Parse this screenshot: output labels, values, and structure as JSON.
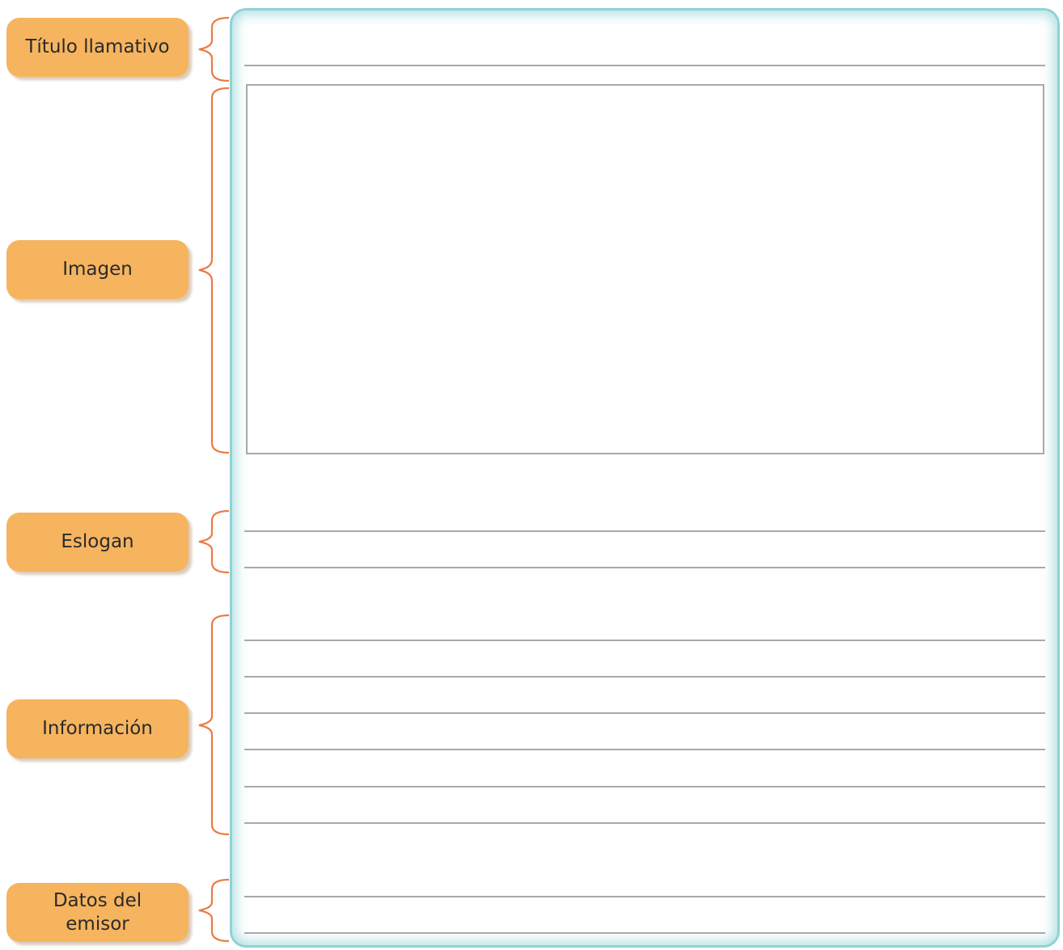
{
  "labels": {
    "title": "Título llamativo",
    "image": "Imagen",
    "slogan": "Eslogan",
    "info": "Información",
    "sender": "Datos del\nemisor"
  },
  "colors": {
    "label_bg": "#f6b45f",
    "brace": "#ec7a45",
    "panel_border": "#8fd2d4",
    "rule": "#a9a9a9"
  }
}
